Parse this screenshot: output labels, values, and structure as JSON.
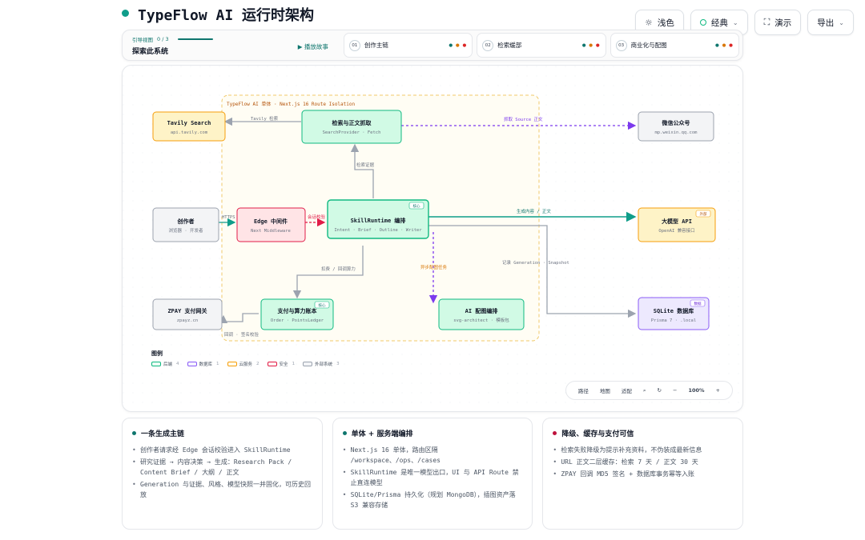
{
  "header": {
    "title": "TypeFlow AI 运行时架构",
    "buttons": [
      {
        "label": "浅色",
        "icon": "sun-icon"
      },
      {
        "label": "经典",
        "icon": "palette-icon"
      },
      {
        "label": "演示",
        "icon": "fullscreen-icon"
      },
      {
        "label": "导出",
        "icon": ""
      }
    ]
  },
  "guide": {
    "label": "引导视图",
    "progress": "0 / 3",
    "subtitle": "探索此系统",
    "action": "▶ 播放故事",
    "steps": [
      {
        "num": "01",
        "label": "创作主链"
      },
      {
        "num": "02",
        "label": "检索缓部"
      },
      {
        "num": "03",
        "label": "商业化与配图"
      }
    ]
  },
  "diagram": {
    "region_label": "TypeFlow AI 单体 · Next.js 16 Route Isolation",
    "nodes": [
      {
        "id": "tavily",
        "title": "Tavily Search",
        "sub": "api.tavily.com"
      },
      {
        "id": "search",
        "title": "检索与正文抓取",
        "sub": "SearchProvider · Fetch"
      },
      {
        "id": "wechat",
        "title": "微信公众号",
        "sub": "mp.weixin.qq.com"
      },
      {
        "id": "creator",
        "title": "创作者",
        "sub": "浏览器 · 开发者"
      },
      {
        "id": "edge",
        "title": "Edge 中间件",
        "sub": "Next Middleware"
      },
      {
        "id": "skill",
        "title": "SkillRuntime 编排",
        "sub": "Intent · Brief · Outline · Writer",
        "badge": "核心"
      },
      {
        "id": "llm",
        "title": "大模型 API",
        "sub": "OpenAI 兼容接口",
        "badge": "外部"
      },
      {
        "id": "zpay",
        "title": "ZPAY 支付网关",
        "sub": "zpayz.cn"
      },
      {
        "id": "order",
        "title": "支付与算力账本",
        "sub": "Order · PointsLedger",
        "badge": "核心"
      },
      {
        "id": "ai_img",
        "title": "AI 配图编排",
        "sub": "svg-architect · 模板包"
      },
      {
        "id": "sqlite",
        "title": "SQLite 数据库",
        "sub": "Prisma 7 · .local",
        "badge": "数据"
      }
    ],
    "edges": [
      {
        "label": "Tavily 检索"
      },
      {
        "label": "检索证据"
      },
      {
        "label": "抓取 Source 正文"
      },
      {
        "label": "HTTPS"
      },
      {
        "label": "会话校验"
      },
      {
        "label": "生成内容 / 正文"
      },
      {
        "label": "扣费 / 回调算力"
      },
      {
        "label": "异步配图任务"
      },
      {
        "label": "记录 Generation · Snapshot"
      },
      {
        "label": "回调 · 签名校验"
      }
    ]
  },
  "legend": {
    "title": "图例",
    "items": [
      {
        "label": "后端",
        "count": "4",
        "color": "#10b981",
        "fill": "#ecfdf5"
      },
      {
        "label": "数据库",
        "count": "1",
        "color": "#8b5cf6",
        "fill": "#f5f3ff"
      },
      {
        "label": "云服务",
        "count": "2",
        "color": "#f59e0b",
        "fill": "#fffbeb"
      },
      {
        "label": "安全",
        "count": "1",
        "color": "#e11d48",
        "fill": "#fff1f2"
      },
      {
        "label": "外部系统",
        "count": "3",
        "color": "#9ca3af",
        "fill": "#f3f4f6"
      }
    ]
  },
  "zoom": {
    "items": [
      "路径",
      "地图",
      "适配"
    ],
    "level": "100%",
    "minus": "−",
    "plus": "+"
  },
  "info": [
    {
      "title": "一条生成主链",
      "color": "#0f766e",
      "items": [
        "创作者请求经 Edge 会话校验进入 SkillRuntime",
        "研究证据 → 内容决策 → 生成：Research Pack / Content Brief / 大纲 / 正文",
        "Generation 与证据、风格、模型快照一并固化，可历史回放"
      ]
    },
    {
      "title": "单体 + 服务端编排",
      "color": "#0f766e",
      "items": [
        "Next.js 16 单体，路由区隔 /workspace、/ops、/cases",
        "SkillRuntime 是唯一模型出口，UI 与 API Route 禁止直连模型",
        "SQLite/Prisma 持久化（规划 MongoDB），插图资产落 S3 兼容存储"
      ]
    },
    {
      "title": "降级、缓存与支付可信",
      "color": "#be123c",
      "items": [
        "检索失败降级为提示补充资料，不伪装成最新信息",
        "URL 正文二层缓存：检索 7 天 / 正文 30 天",
        "ZPAY 回调 MD5 签名 + 数据库事务幂等入账"
      ]
    }
  ]
}
